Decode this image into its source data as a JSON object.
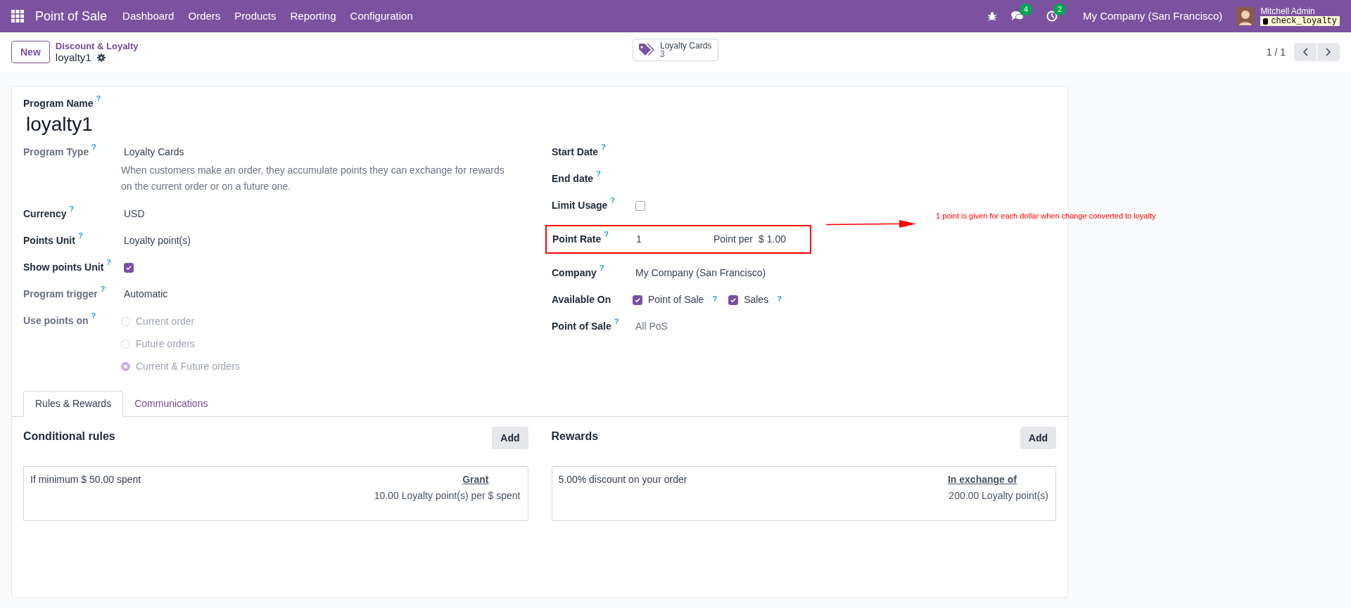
{
  "navbar": {
    "app_name": "Point of Sale",
    "menu": [
      "Dashboard",
      "Orders",
      "Products",
      "Reporting",
      "Configuration"
    ],
    "messages_count": "4",
    "activities_count": "2",
    "company": "My Company (San Francisco)",
    "user_name": "Mitchell Admin",
    "database": "check_loyalty"
  },
  "control": {
    "new_button": "New",
    "breadcrumb_parent": "Discount & Loyalty",
    "record_name": "loyalty1",
    "smart_button": {
      "label": "Loyalty Cards",
      "value": "3"
    },
    "pager": "1 / 1"
  },
  "form": {
    "program_name_label": "Program Name",
    "program_name_help": "?",
    "program_name": "loyalty1",
    "left_fields": [
      {
        "kind": "text",
        "label": "Program Type",
        "help": "?",
        "muted": true,
        "value": "Loyalty Cards",
        "description": "When customers make an order, they accumulate points they can exchange for rewards on the current order or on a future one."
      },
      {
        "kind": "text",
        "label": "Currency",
        "help": "?",
        "muted": false,
        "value": "USD"
      },
      {
        "kind": "text",
        "label": "Points Unit",
        "help": "?",
        "muted": false,
        "value": "Loyalty point(s)"
      },
      {
        "kind": "checkbox",
        "label": "Show points Unit",
        "help": "?",
        "muted": false,
        "checked": true
      },
      {
        "kind": "text",
        "label": "Program trigger",
        "help": "?",
        "muted": true,
        "value": "Automatic"
      },
      {
        "kind": "radios",
        "label": "Use points on",
        "help": "?",
        "muted": true,
        "options": [
          {
            "label": "Current order",
            "selected": false
          },
          {
            "label": "Future orders",
            "selected": false
          },
          {
            "label": "Current & Future orders",
            "selected": true
          }
        ]
      }
    ],
    "right_fields": [
      {
        "kind": "empty",
        "label": "Start Date",
        "help": "?",
        "muted": false
      },
      {
        "kind": "empty",
        "label": "End date",
        "help": "?",
        "muted": false
      },
      {
        "kind": "checkbox",
        "label": "Limit Usage",
        "help": "?",
        "muted": false,
        "checked": false
      },
      {
        "kind": "rate",
        "label": "Point Rate",
        "help": "?",
        "muted": false,
        "value": "1",
        "unit_label": "Point per",
        "amount": "$ 1.00",
        "highlighted": true
      },
      {
        "kind": "text",
        "label": "Company",
        "help": "?",
        "muted": false,
        "value": "My Company (San Francisco)"
      },
      {
        "kind": "checkboxes",
        "label": "Available On",
        "muted": false,
        "options": [
          {
            "label": "Point of Sale",
            "help": "?",
            "checked": true
          },
          {
            "label": "Sales",
            "help": "?",
            "checked": true
          }
        ]
      },
      {
        "kind": "placeholder",
        "label": "Point of Sale",
        "help": "?",
        "muted": false,
        "placeholder": "All PoS"
      }
    ],
    "annotation": "1 point is given for each dollar when change converted to loyalty",
    "tabs": [
      {
        "label": "Rules & Rewards",
        "selected": true
      },
      {
        "label": "Communications",
        "selected": false
      }
    ],
    "panels": [
      {
        "title": "Conditional rules",
        "add_button": "Add",
        "rows": [
          {
            "text": "If minimum $ 50.00 spent",
            "column_title": "Grant",
            "detail": "10.00 Loyalty point(s) per $ spent"
          }
        ]
      },
      {
        "title": "Rewards",
        "add_button": "Add",
        "rows": [
          {
            "text": "5.00% discount on your order",
            "column_title": "In exchange of",
            "detail": "200.00 Loyalty point(s)"
          }
        ]
      }
    ]
  }
}
